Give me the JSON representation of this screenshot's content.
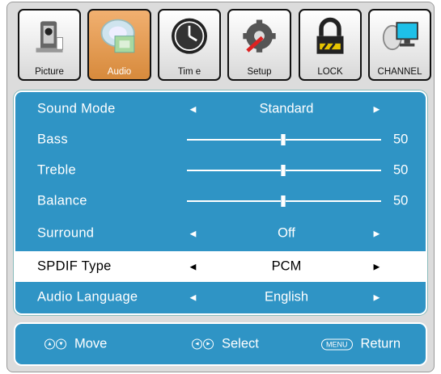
{
  "tabs": [
    {
      "label": "Picture",
      "icon": "camera-icon",
      "active": false
    },
    {
      "label": "Audio",
      "icon": "speaker-icon",
      "active": true
    },
    {
      "label": "Tim e",
      "icon": "clock-icon",
      "active": false
    },
    {
      "label": "Setup",
      "icon": "tools-icon",
      "active": false
    },
    {
      "label": "LOCK",
      "icon": "lock-icon",
      "active": false
    },
    {
      "label": "CHANNEL",
      "icon": "satellite-dish-icon",
      "active": false
    }
  ],
  "menu": {
    "items": [
      {
        "name": "Sound Mode",
        "value": "Standard"
      },
      {
        "name": "Bass",
        "value": "50"
      },
      {
        "name": "Treble",
        "value": "50"
      },
      {
        "name": "Balance",
        "value": "50"
      },
      {
        "name": "Surround",
        "value": "Off"
      },
      {
        "name": "SPDIF Type",
        "value": "PCM"
      },
      {
        "name": "Audio Language",
        "value": "English"
      }
    ],
    "arrow_left": "◄",
    "arrow_right": "►"
  },
  "footer": {
    "move_label": "Move",
    "select_label": "Select",
    "menu_key": "MENU",
    "return_label": "Return"
  },
  "colors": {
    "menu_bg": "#2f94c5",
    "active_tab": "#e39a4f",
    "selected_row": "#ffffff"
  }
}
